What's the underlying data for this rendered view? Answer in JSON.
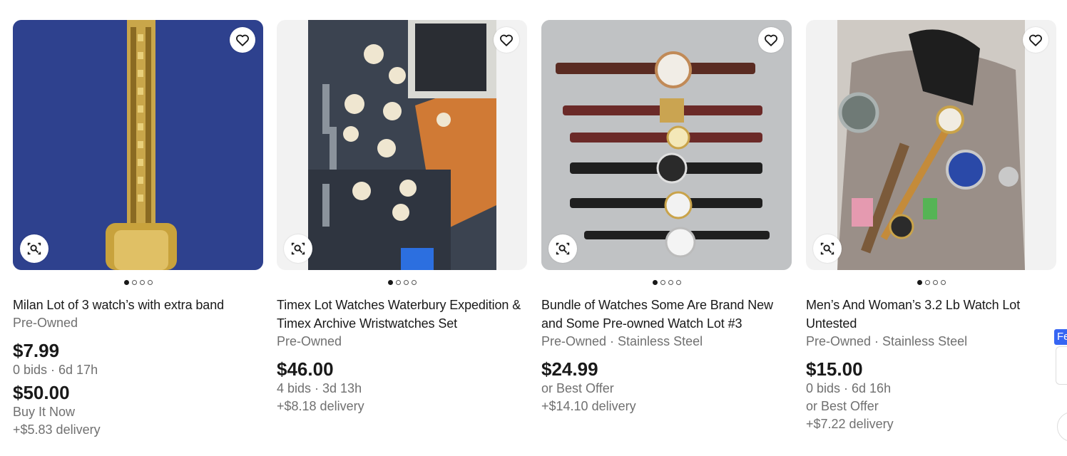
{
  "listings": [
    {
      "title": "Milan Lot of 3 watch’s with extra band",
      "condition": "Pre-Owned",
      "price": "$7.99",
      "bids_time": "0 bids · 6d 17h",
      "buy_now_price": "$50.00",
      "buy_now_label": "Buy It Now",
      "delivery": "+$5.83 delivery"
    },
    {
      "title": "Timex Lot Watches Waterbury Expedition & Timex Archive Wristwatches Set",
      "condition": "Pre-Owned",
      "price": "$46.00",
      "bids_time": "4 bids · 3d 13h",
      "delivery": "+$8.18 delivery"
    },
    {
      "title": "Bundle of Watches Some Are Brand New and Some Pre-owned Watch Lot #3",
      "condition": "Pre-Owned · Stainless Steel",
      "price": "$24.99",
      "offer": "or Best Offer",
      "delivery": "+$14.10 delivery"
    },
    {
      "title": "Men’s And Woman’s 3.2 Lb Watch Lot Untested",
      "condition": "Pre-Owned · Stainless Steel",
      "price": "$15.00",
      "bids_time": "0 bids · 6d 16h",
      "offer": "or Best Offer",
      "delivery": "+$7.22 delivery"
    }
  ],
  "side_tab_label": "Fe",
  "icons": {
    "favorite": "heart-outline-icon",
    "visual_search": "image-search-icon"
  },
  "colors": {
    "text": "#191919",
    "secondary": "#707070",
    "accent": "#3665f3"
  }
}
